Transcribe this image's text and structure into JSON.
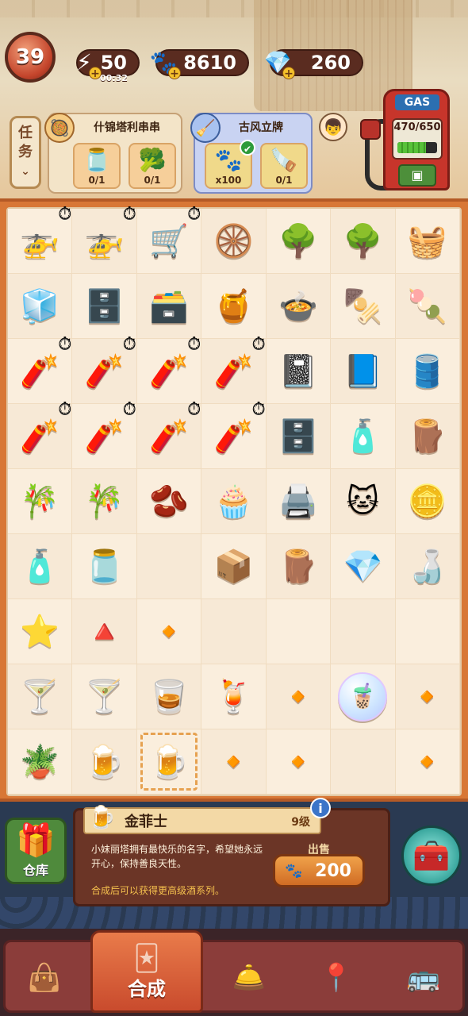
{
  "player": {
    "level": "39"
  },
  "resources": {
    "energy": {
      "value": "50",
      "timer": "00:32",
      "icon": "energy-bolt-icon"
    },
    "coins": {
      "value": "8610",
      "icon": "paw-coin-icon"
    },
    "gems": {
      "value": "260",
      "icon": "blue-gem-icon"
    }
  },
  "gas": {
    "label": "GAS",
    "reading": "470/650",
    "fraction": 0.723
  },
  "tasks": {
    "button_label": [
      "任",
      "务"
    ],
    "card1": {
      "title": "什锦塔利串串",
      "slots": [
        {
          "emoji": "🫙",
          "count": "0/1"
        },
        {
          "emoji": "🥦",
          "count": "0/1"
        }
      ]
    },
    "card2": {
      "title": "古风立牌",
      "slots": [
        {
          "emoji": "🐾",
          "count": "x100"
        },
        {
          "emoji": "🪚",
          "count": "0/1"
        }
      ]
    }
  },
  "board": [
    [
      "🚁",
      "🚁",
      "🛒",
      "🛞",
      "🌳",
      "🌳",
      "🧺"
    ],
    [
      "🧊",
      "🗄️",
      "🗃️",
      "🍯",
      "🍲",
      "🍢",
      "🍡"
    ],
    [
      "🧨",
      "🧨",
      "🧨",
      "🧨",
      "📓",
      "📘",
      "🛢️"
    ],
    [
      "🧨",
      "🧨",
      "🧨",
      "🧨",
      "🗄️",
      "🧴",
      "🪵"
    ],
    [
      "🎋",
      "🎋",
      "🫘",
      "🧁",
      "🖨️",
      "🐱",
      "🪙"
    ],
    [
      "🧴",
      "🫙",
      "",
      "📦",
      "🪵",
      "💎",
      "🍶"
    ],
    [
      "⭐",
      "🔺",
      "🔸",
      "",
      "",
      "",
      ""
    ],
    [
      "🍸",
      "🍸",
      "🥃",
      "🍹",
      "🔸",
      "🧋",
      "🔸"
    ],
    [
      "🪴",
      "🍺",
      "🍺",
      "🔸",
      "🔸",
      "",
      "🔸"
    ]
  ],
  "timers": [
    [
      0,
      0
    ],
    [
      0,
      1
    ],
    [
      0,
      2
    ],
    [
      2,
      0
    ],
    [
      2,
      1
    ],
    [
      2,
      2
    ],
    [
      2,
      3
    ],
    [
      3,
      0
    ],
    [
      3,
      1
    ],
    [
      3,
      2
    ],
    [
      3,
      3
    ]
  ],
  "selected": [
    8,
    2
  ],
  "bubble": [
    7,
    5
  ],
  "info": {
    "item_name": "金菲士",
    "item_level": "9级",
    "description": "小妹丽塔拥有最快乐的名字，希望她永远开心，保持善良天性。",
    "hint": "合成后可以获得更高级酒系列。",
    "sell_label": "出售",
    "sell_price": "200",
    "warehouse_label": "仓库"
  },
  "nav": {
    "merge_label": "合成",
    "items": [
      "shopping-bag-icon",
      "merge-icon",
      "service-bell-icon",
      "map-pin-icon",
      "bus-icon"
    ]
  },
  "colors": {
    "accent": "#d87736",
    "board_bg": "#f7e9d6",
    "nav_bg": "#8b3d3a"
  }
}
